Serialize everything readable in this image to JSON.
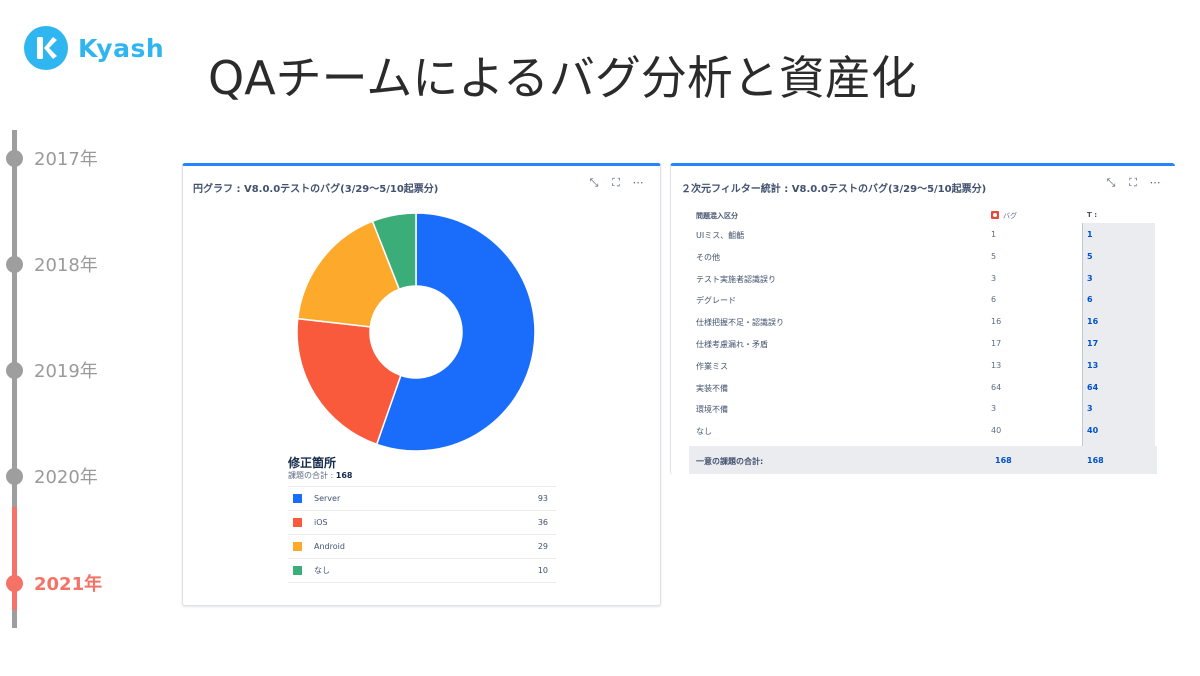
{
  "brand": {
    "name": "Kyash",
    "color": "#2fb6f0"
  },
  "slide": {
    "title": "QAチームによるバグ分析と資産化"
  },
  "timeline": {
    "items": [
      {
        "label": "2017年",
        "active": false
      },
      {
        "label": "2018年",
        "active": false
      },
      {
        "label": "2019年",
        "active": false
      },
      {
        "label": "2020年",
        "active": false
      },
      {
        "label": "2021年",
        "active": true
      }
    ],
    "active_color": "#f47266"
  },
  "pie_card": {
    "title": "円グラフ : V8.0.0テストのバグ(3/29〜5/10起票分)",
    "legend_title": "修正箇所",
    "total_label": "課題の合計 : ",
    "total_value": "168"
  },
  "table_card": {
    "title": "２次元フィルター統計 : V8.0.0テストのバグ(3/29〜5/10起票分)",
    "col_header_1": "問題混入区分",
    "col_header_2": "バグ",
    "col_header_3": "T :",
    "footer_label": "一意の課題の合計:",
    "footer_value_2": "168",
    "footer_value_3": "168"
  },
  "chart_data": [
    {
      "type": "pie",
      "title": "円グラフ : V8.0.0テストのバグ(3/29〜5/10起票分)",
      "legend_title": "修正箇所",
      "donut": true,
      "legend_placement": "bottom",
      "slices": [
        {
          "label": "Server",
          "value": 93,
          "color": "#1a6dfb"
        },
        {
          "label": "iOS",
          "value": 36,
          "color": "#fa5a3c"
        },
        {
          "label": "Android",
          "value": 29,
          "color": "#fdaa2c"
        },
        {
          "label": "なし",
          "value": 10,
          "color": "#3aad79"
        }
      ]
    },
    {
      "type": "table",
      "title": "２次元フィルター統計 : V8.0.0テストのバグ(3/29〜5/10起票分)",
      "columns": [
        "問題混入区分",
        "バグ",
        "T :"
      ],
      "rows": [
        {
          "label": "UIミス、齟齬",
          "bug": 1,
          "total": 1
        },
        {
          "label": "その他",
          "bug": 5,
          "total": 5
        },
        {
          "label": "テスト実施者認識誤り",
          "bug": 3,
          "total": 3
        },
        {
          "label": "デグレード",
          "bug": 6,
          "total": 6
        },
        {
          "label": "仕様把握不足・認識誤り",
          "bug": 16,
          "total": 16
        },
        {
          "label": "仕様考慮漏れ・矛盾",
          "bug": 17,
          "total": 17
        },
        {
          "label": "作業ミス",
          "bug": 13,
          "total": 13
        },
        {
          "label": "実装不備",
          "bug": 64,
          "total": 64
        },
        {
          "label": "環境不備",
          "bug": 3,
          "total": 3
        },
        {
          "label": "なし",
          "bug": 40,
          "total": 40
        }
      ],
      "footer": {
        "label": "一意の課題の合計:",
        "bug": 168,
        "total": 168
      }
    }
  ]
}
